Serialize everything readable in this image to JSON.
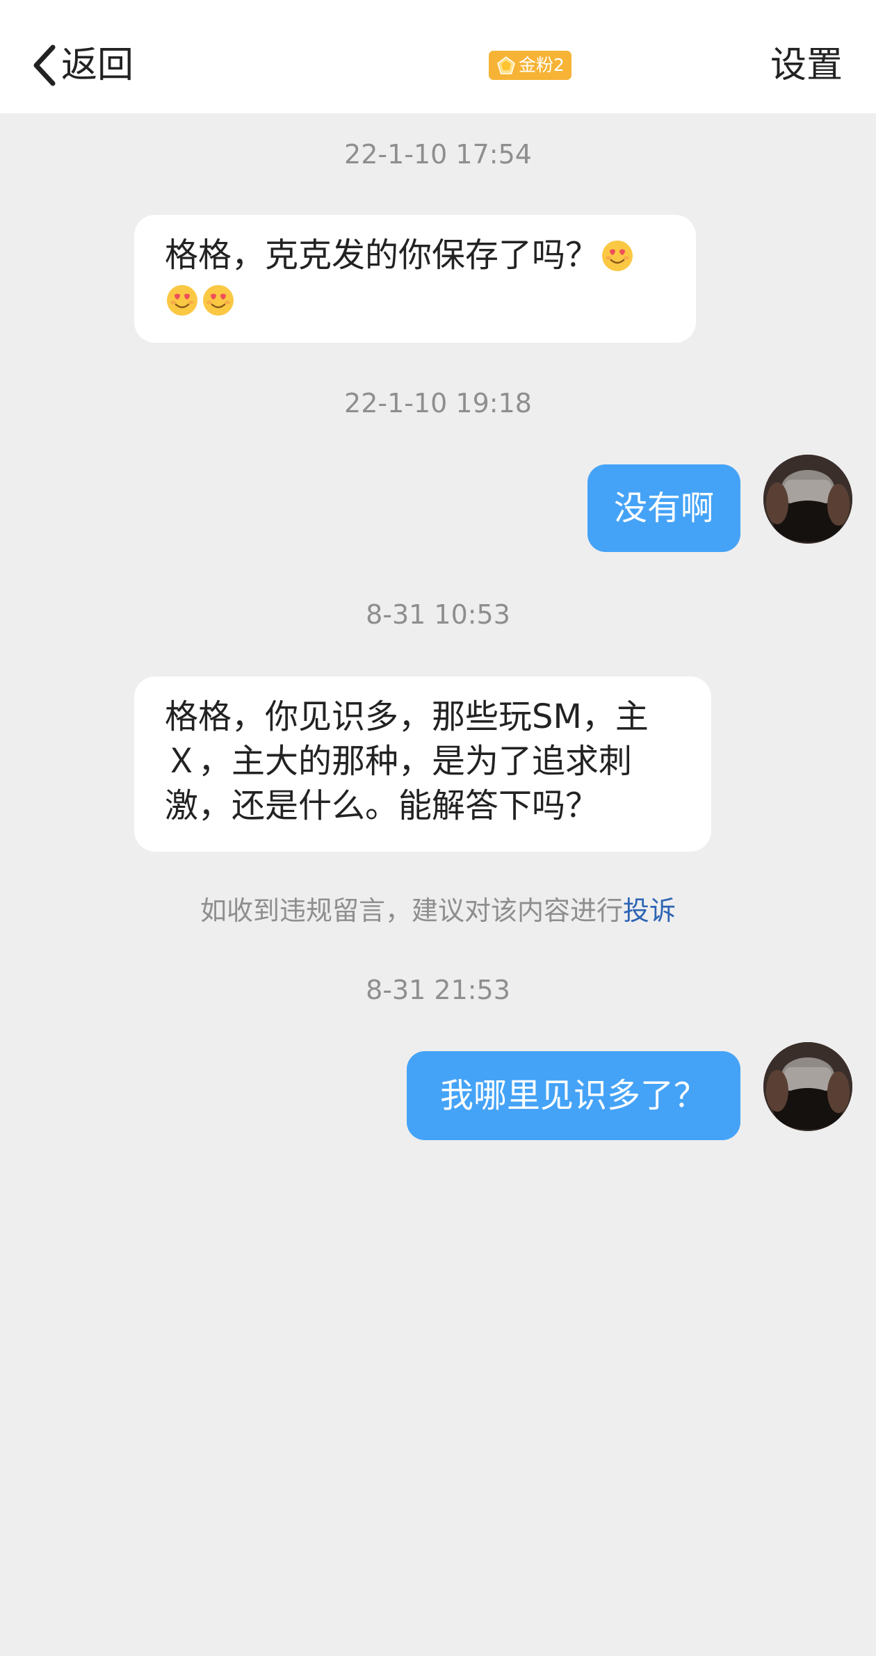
{
  "header": {
    "back_label": "返回",
    "badge_label": "金粉2",
    "settings_label": "设置",
    "back_icon": "chevron-left-icon",
    "badge_icon": "pentagon-gem-icon"
  },
  "messages": [
    {
      "timestamp": "22-1-10 17:54",
      "direction": "received",
      "line1": "格格，克克发的你保存了吗？",
      "emoji_count": 3,
      "emoji": "smiling-face-heart-eyes-icon"
    },
    {
      "timestamp": "22-1-10 19:18",
      "direction": "sent",
      "text": "没有啊"
    },
    {
      "timestamp": "8-31 10:53",
      "direction": "received",
      "lines": [
        "格格，你见识多，那些玩SM，主",
        "Ｘ，主大的那种，是为了追求刺",
        "激，还是什么。能解答下吗？"
      ]
    },
    {
      "timestamp": "8-31 21:53",
      "direction": "sent",
      "text": "我哪里见识多了？"
    }
  ],
  "notice": {
    "text": "如收到违规留言，建议对该内容进行",
    "link": "投诉"
  },
  "colors": {
    "chat_background": "#eeeeef",
    "sent_bubble": "#45a3f7",
    "received_bubble": "#ffffff",
    "badge": "#f6b335",
    "link": "#2d64b3",
    "timestamp_text": "#8e8e8e"
  }
}
